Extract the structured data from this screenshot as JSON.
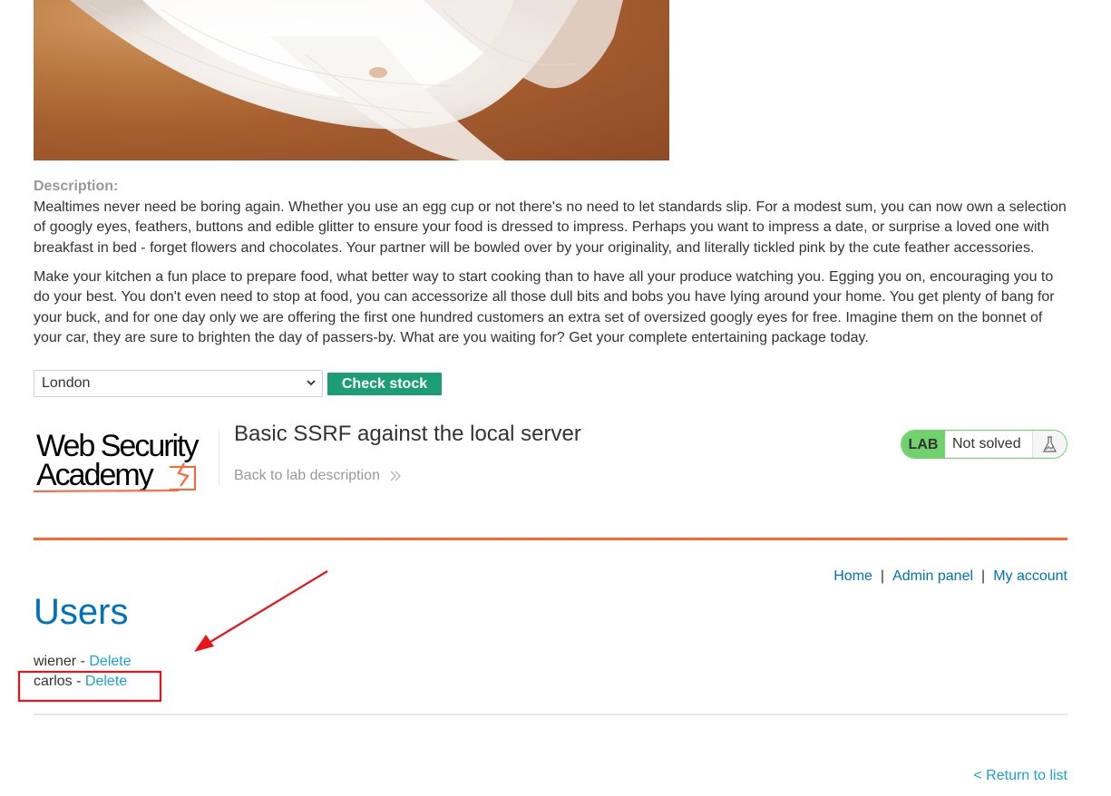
{
  "product": {
    "description_label": "Description:",
    "paragraphs": [
      "Mealtimes never need be boring again. Whether you use an egg cup or not there's no need to let standards slip. For a modest sum, you can now own a selection of googly eyes, feathers, buttons and edible glitter to ensure your food is dressed to impress. Perhaps you want to impress a date, or surprise a loved one with breakfast in bed - forget flowers and chocolates. Your partner will be bowled over by your originality, and literally tickled pink by the cute feather accessories.",
      "Make your kitchen a fun place to prepare food, what better way to start cooking than to have all your produce watching you. Egging you on, encouraging you to do your best. You don't even need to stop at food, you can accessorize all those dull bits and bobs you have lying around your home. You get plenty of bang for your buck, and for one day only we are offering the first one hundred customers an extra set of oversized googly eyes for free. Imagine them on the bonnet of your car, they are sure to brighten the day of passers-by. What are you waiting for? Get your complete entertaining package today."
    ]
  },
  "stock": {
    "selected_store": "London",
    "check_button_label": "Check stock"
  },
  "academy": {
    "logo_line1": "Web Security",
    "logo_line2": "Academy",
    "lab_title": "Basic SSRF against the local server",
    "back_link": "Back to lab description",
    "badge_label": "LAB",
    "badge_status": "Not solved"
  },
  "nav": {
    "home": "Home",
    "admin_panel": "Admin panel",
    "my_account": "My account",
    "separator": "|"
  },
  "users": {
    "heading": "Users",
    "list": [
      {
        "name": "wiener",
        "separator": " - ",
        "action": "Delete"
      },
      {
        "name": "carlos",
        "separator": " - ",
        "action": "Delete"
      }
    ]
  },
  "footer": {
    "return_link": "< Return to list"
  },
  "colors": {
    "accent_blue": "#0071bc",
    "link_blue": "#1ba1d6",
    "button_green": "#1d9d74",
    "lab_green": "#70d16d",
    "orange_rule": "#ff6633",
    "annotation_red": "#e8141b"
  }
}
